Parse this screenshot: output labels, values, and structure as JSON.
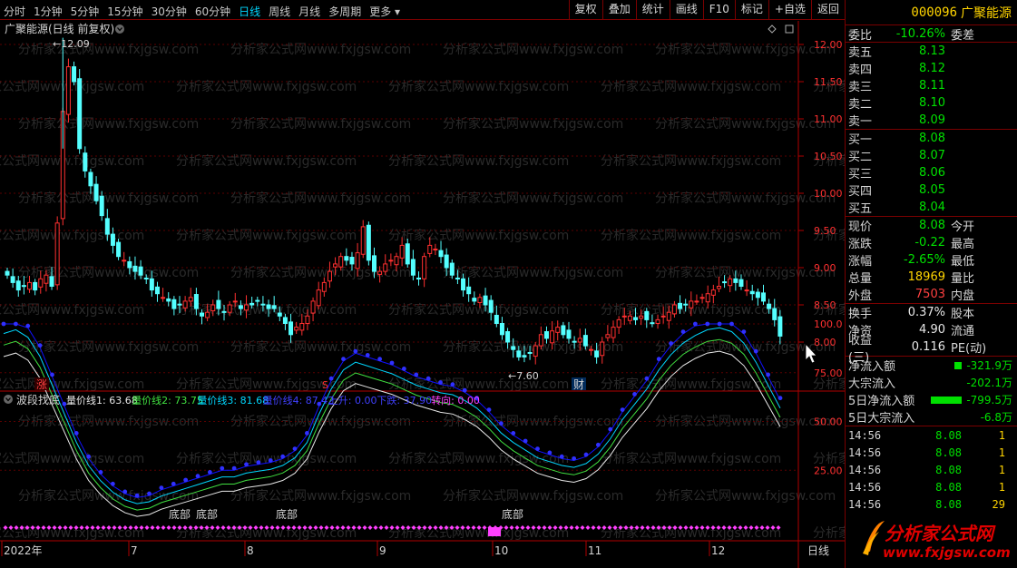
{
  "menu": {
    "periods": [
      "分时",
      "1分钟",
      "5分钟",
      "15分钟",
      "30分钟",
      "60分钟",
      "日线",
      "周线",
      "月线",
      "多周期",
      "更多 ▾"
    ],
    "active_period": "日线",
    "tools": [
      "复权",
      "叠加",
      "统计",
      "画线",
      "F10",
      "标记",
      "+自选",
      "返回"
    ]
  },
  "chart": {
    "title": "广聚能源(日线 前复权)",
    "watermark": "分析家公式网www.fxjgsw.com",
    "price_ticks": [
      "12.00",
      "11.50",
      "11.00",
      "10.50",
      "10.00",
      "9.50",
      "9.00",
      "8.50",
      "8.00"
    ],
    "high_label": "12.09",
    "low_label": "7.60",
    "markers": {
      "limit": "涨",
      "s": "S",
      "fin": "财"
    },
    "indicator": {
      "name": "波段找底",
      "labels": [
        {
          "text": "量价线1: 63.68",
          "color": "#e8e8e8"
        },
        {
          "text": "量价线2: 73.75",
          "color": "#40e040"
        },
        {
          "text": "量价线3: 81.68",
          "color": "#00d7ff"
        },
        {
          "text": "量价线4: 87.42",
          "color": "#4040ff"
        },
        {
          "text": "上升: 0.00",
          "color": "#4040ff"
        },
        {
          "text": "下跌: 37.90",
          "color": "#4040ff"
        },
        {
          "text": "转向: 0.00",
          "color": "#ff40ff"
        }
      ],
      "ticks": [
        "100.0",
        "75.00",
        "50.00",
        "25.00"
      ],
      "bottom_label": "底部"
    },
    "dates": [
      "2022年",
      "7",
      "8",
      "9",
      "10",
      "11",
      "12"
    ],
    "period_tag": "日线"
  },
  "quote": {
    "code": "000096",
    "name": "广聚能源",
    "weibi_label": "委比",
    "weibi": "-10.26%",
    "weicha_label": "委差",
    "asks": [
      {
        "label": "卖五",
        "price": "8.13"
      },
      {
        "label": "卖四",
        "price": "8.12"
      },
      {
        "label": "卖三",
        "price": "8.11"
      },
      {
        "label": "卖二",
        "price": "8.10"
      },
      {
        "label": "卖一",
        "price": "8.09"
      }
    ],
    "bids": [
      {
        "label": "买一",
        "price": "8.08"
      },
      {
        "label": "买二",
        "price": "8.07"
      },
      {
        "label": "买三",
        "price": "8.06"
      },
      {
        "label": "买四",
        "price": "8.05"
      },
      {
        "label": "买五",
        "price": "8.04"
      }
    ],
    "stats": [
      {
        "l": "现价",
        "v": "8.08",
        "vc": "g",
        "l2": "今开"
      },
      {
        "l": "涨跌",
        "v": "-0.22",
        "vc": "g",
        "l2": "最高"
      },
      {
        "l": "涨幅",
        "v": "-2.65%",
        "vc": "g",
        "l2": "最低"
      },
      {
        "l": "总量",
        "v": "18969",
        "vc": "y",
        "l2": "量比"
      },
      {
        "l": "外盘",
        "v": "7503",
        "vc": "r",
        "l2": "内盘"
      }
    ],
    "fund": [
      {
        "l": "换手",
        "v": "0.37%",
        "l2": "股本"
      },
      {
        "l": "净资",
        "v": "4.90",
        "l2": "流通"
      },
      {
        "l": "收益(三)",
        "v": "0.116",
        "l2": "PE(动)"
      }
    ],
    "flows": [
      {
        "l": "净流入额",
        "v": "-321.9万",
        "bar": 0.25
      },
      {
        "l": "大宗流入",
        "v": "-202.1万",
        "bar": 0.0
      },
      {
        "l": "5日净流入额",
        "v": "-799.5万",
        "bar": 1.0
      },
      {
        "l": "5日大宗流入",
        "v": "-6.8万",
        "bar": 0.0
      }
    ],
    "ticks": [
      {
        "t": "14:56",
        "p": "8.08",
        "v": "1"
      },
      {
        "t": "14:56",
        "p": "8.08",
        "v": "1"
      },
      {
        "t": "14:56",
        "p": "8.08",
        "v": "1"
      },
      {
        "t": "14:56",
        "p": "8.08",
        "v": "1"
      },
      {
        "t": "14:56",
        "p": "8.08",
        "v": "29"
      }
    ]
  },
  "logo": {
    "text": "分析家公式网",
    "url": "www.fxjgsw.com"
  }
}
